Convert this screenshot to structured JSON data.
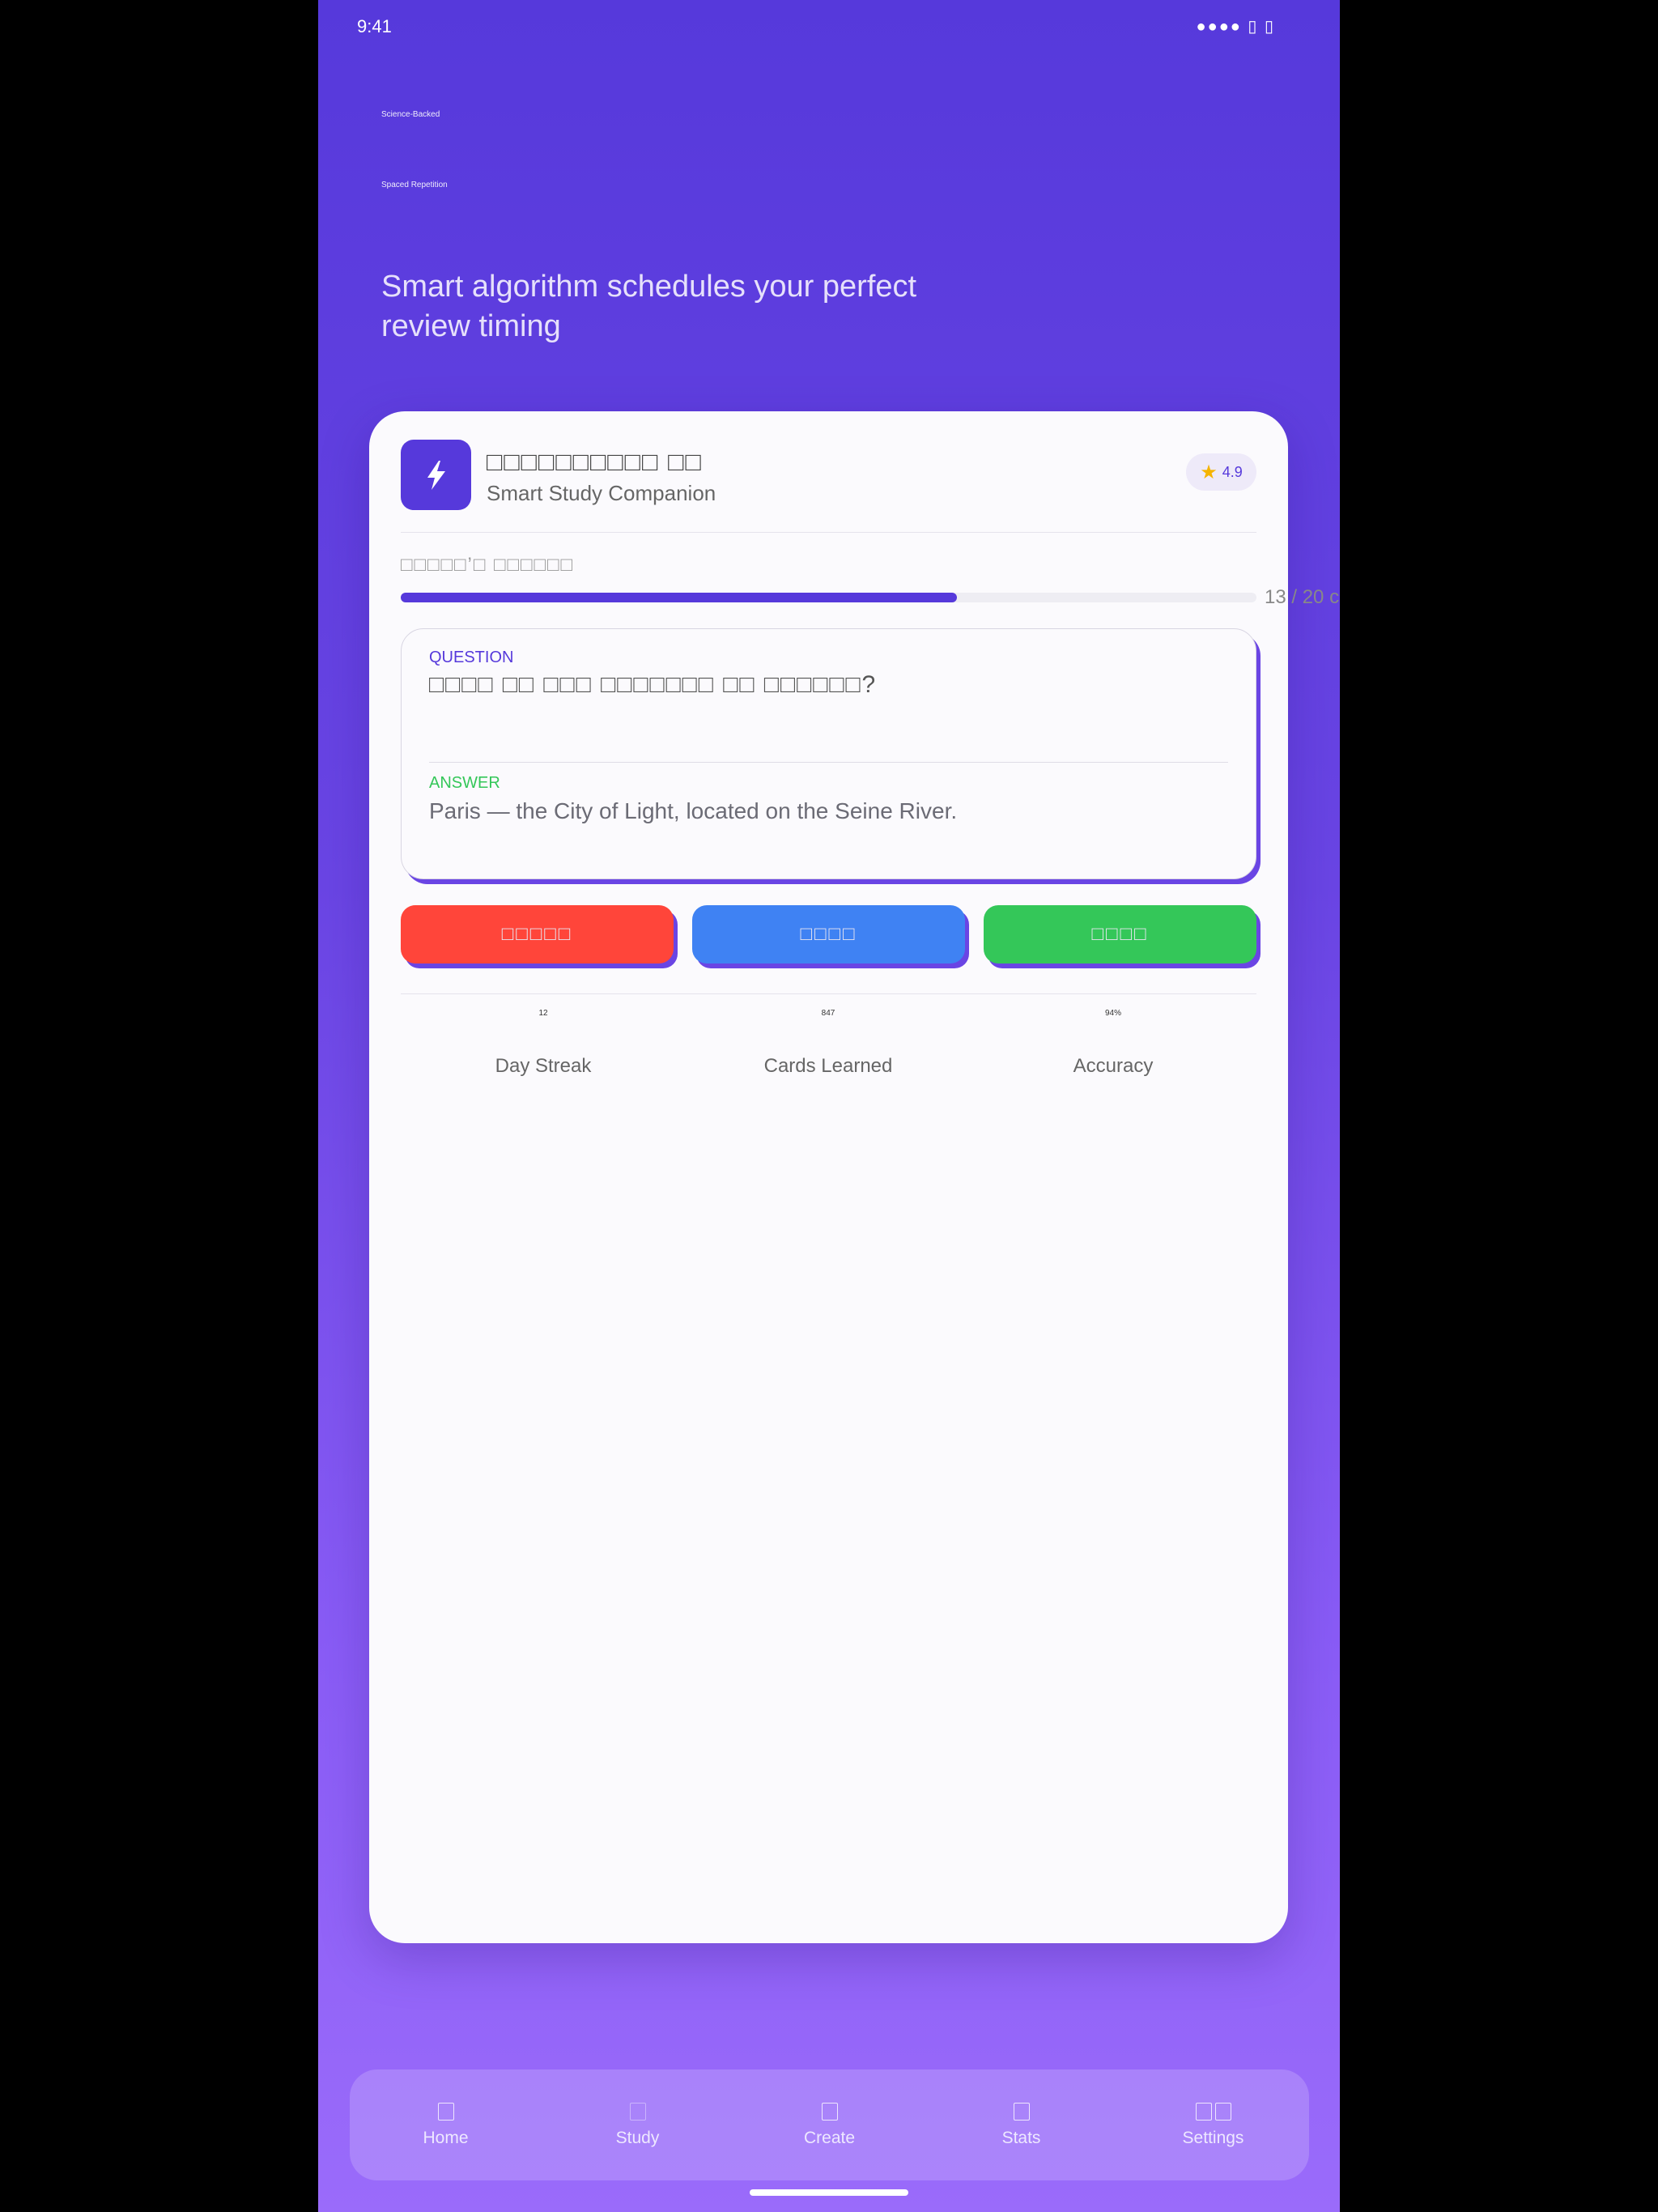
{
  "status": {
    "time": "9:41",
    "right": "●●●● ▯ ▯"
  },
  "hero": {
    "tag1": "Science-Backed",
    "tag2": "Spaced Repetition",
    "headline": "Smart algorithm schedules your perfect review timing"
  },
  "app": {
    "title": "□□□□□□□□□□ □□",
    "subtitle": "Smart Study Companion",
    "rating": "4.9",
    "star_icon": "star-icon",
    "icon": "lightning-icon"
  },
  "progress": {
    "label": "□□□□□’□ □□□□□□",
    "count": "13 / 20 c",
    "fraction": 0.65
  },
  "flashcard": {
    "question_label": "QUESTION",
    "question": "□□□□ □□ □□□ □□□□□□□ □□ □□□□□□?",
    "answer_label": "ANSWER",
    "answer": "Paris — the City of Light, located on the Seine River."
  },
  "buttons": {
    "again": "□□□□□",
    "good": "□□□□",
    "easy": "□□□□"
  },
  "stats": [
    {
      "value": "12",
      "label": "Day Streak"
    },
    {
      "value": "847",
      "label": "Cards Learned"
    },
    {
      "value": "94%",
      "label": "Accuracy"
    }
  ],
  "tabs": [
    {
      "label": "Home",
      "icon": "home-icon"
    },
    {
      "label": "Study",
      "icon": "book-icon"
    },
    {
      "label": "Create",
      "icon": "plus-icon"
    },
    {
      "label": "Stats",
      "icon": "chart-icon"
    },
    {
      "label": "Settings",
      "icon": "gear-icon"
    }
  ],
  "colors": {
    "brand": "#5639DB",
    "again": "#FF453A",
    "good": "#3F82F3",
    "easy": "#34C759",
    "star": "#F5B400"
  }
}
